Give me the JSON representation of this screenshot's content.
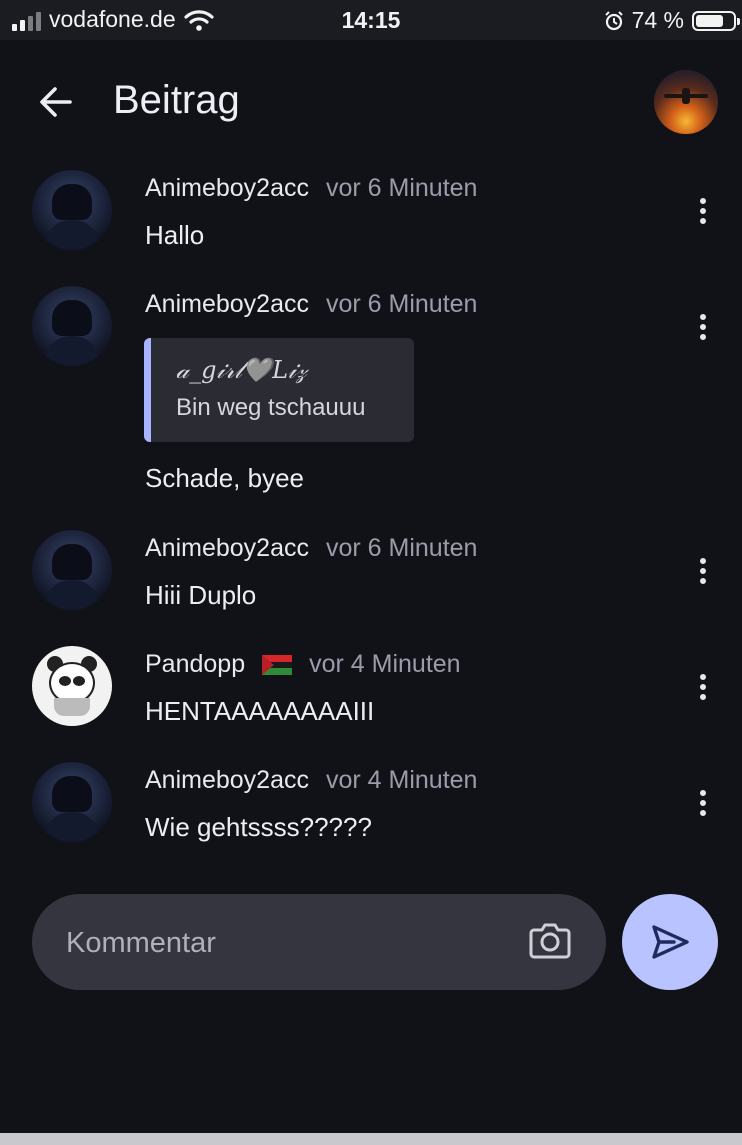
{
  "status_bar": {
    "carrier": "vodafone.de",
    "time": "14:15",
    "battery_percent": "74 %",
    "battery_level": 0.74
  },
  "header": {
    "title": "Beitrag",
    "back_icon": "arrow-left-icon",
    "profile_avatar": "profile-avatar"
  },
  "comments": [
    {
      "author": "Animeboy2acc",
      "time": "vor 6 Minuten",
      "text": "Hallo",
      "avatar": "anime"
    },
    {
      "author": "Animeboy2acc",
      "time": "vor 6 Minuten",
      "text": "Schade, byee",
      "avatar": "anime",
      "quote": {
        "author": "𝒶_𝑔𝒾𝓇𝓁🩶𝐿𝒾𝓏",
        "text": "Bin weg tschauuu"
      }
    },
    {
      "author": "Animeboy2acc",
      "time": "vor 6 Minuten",
      "text": "Hiii Duplo",
      "avatar": "anime"
    },
    {
      "author": "Pandopp",
      "flag_icon": "flag-icon",
      "time": "vor 4 Minuten",
      "text": "HENTAAAAAAAAIII",
      "avatar": "panda"
    },
    {
      "author": "Animeboy2acc",
      "time": "vor 4 Minuten",
      "text": "Wie gehtssss?????",
      "avatar": "anime"
    }
  ],
  "composer": {
    "placeholder": "Kommentar",
    "camera_icon": "camera-icon",
    "send_icon": "send-icon"
  },
  "colors": {
    "background": "#111218",
    "accent": "#b9c3ff",
    "quote_bar": "#a9b4ff",
    "muted_text": "#9b9caa"
  }
}
